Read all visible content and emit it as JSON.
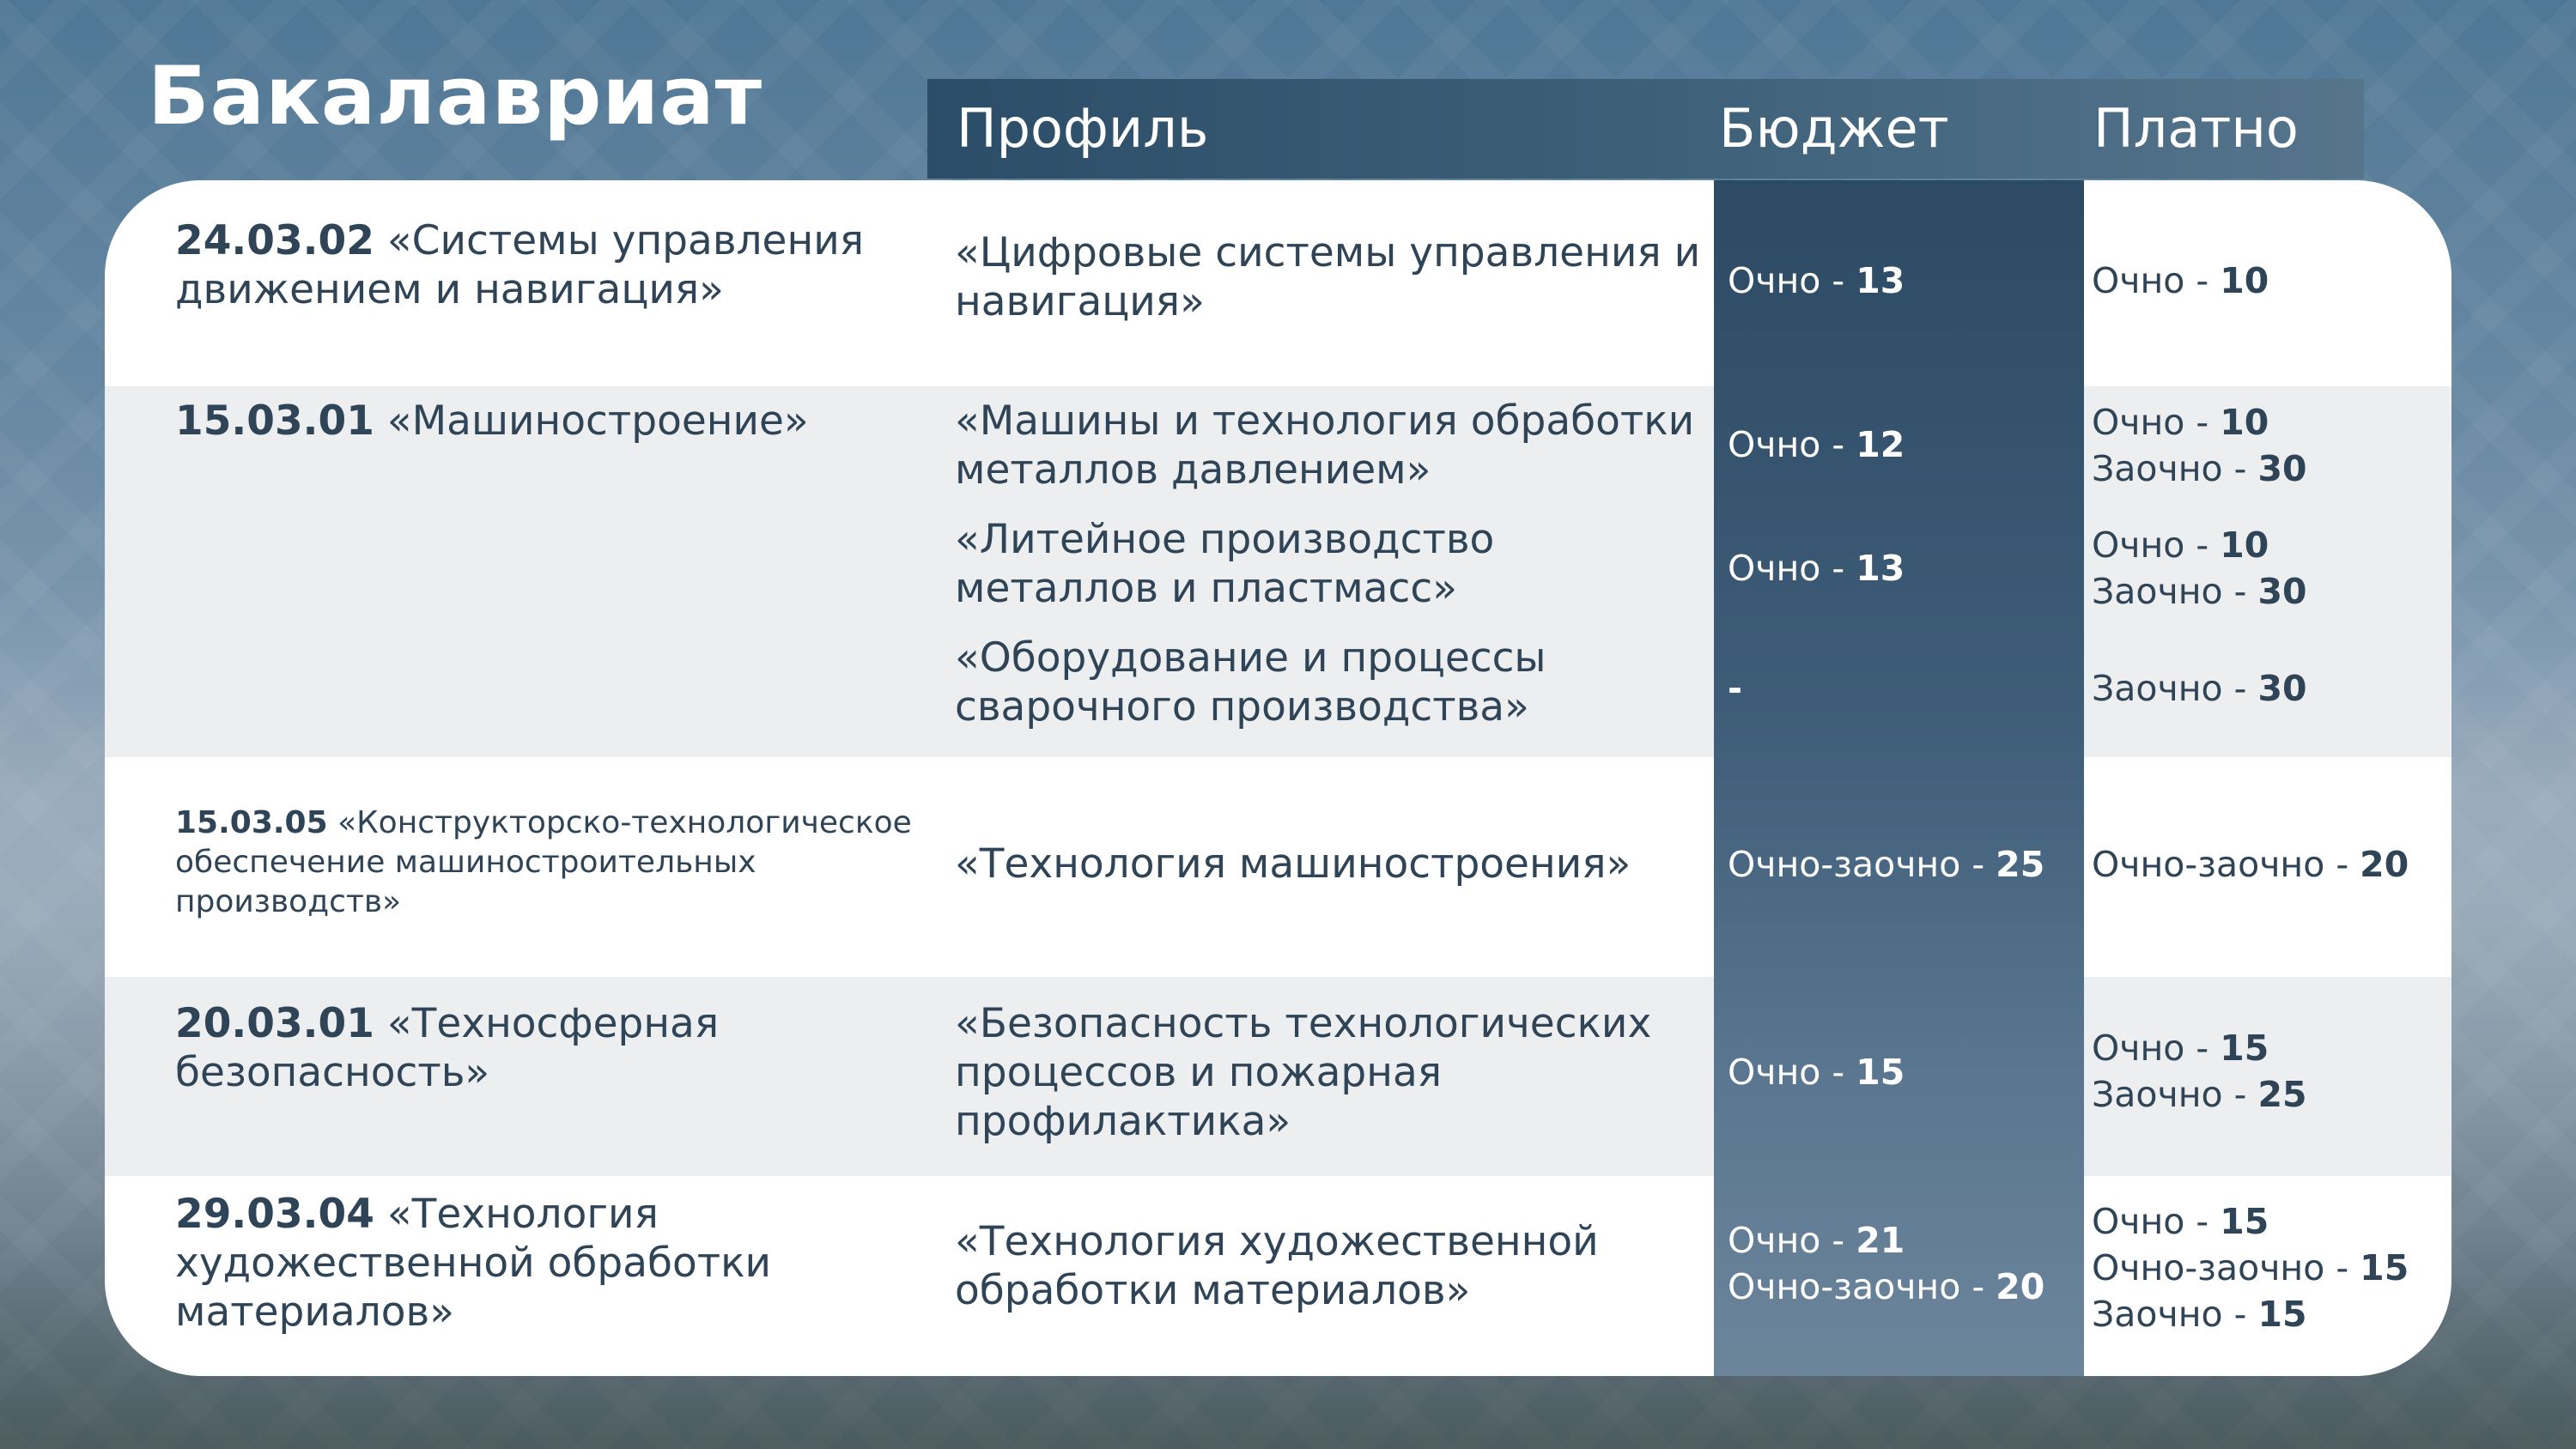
{
  "title": "Бакалавриат",
  "header": {
    "profile": "Профиль",
    "budget": "Бюджет",
    "paid": "Платно"
  },
  "rows": [
    {
      "code": "24.03.02",
      "direction": " «Системы управления движением и навигация»",
      "profiles": [
        {
          "name": "«Цифровые системы управления и навигация»",
          "budget": [
            {
              "mode": "Очно - ",
              "seats": "13"
            }
          ],
          "paid": [
            {
              "mode": "Очно - ",
              "seats": "10"
            }
          ]
        }
      ]
    },
    {
      "code": "15.03.01",
      "direction": " «Машиностроение»",
      "profiles": [
        {
          "name": "«Машины и технология обработки металлов давлением»",
          "budget": [
            {
              "mode": "Очно - ",
              "seats": "12"
            }
          ],
          "paid": [
            {
              "mode": "Очно - ",
              "seats": "10"
            },
            {
              "mode": "Заочно - ",
              "seats": "30"
            }
          ]
        },
        {
          "name": "«Литейное производство металлов и пластмасс»",
          "budget": [
            {
              "mode": "Очно - ",
              "seats": "13"
            }
          ],
          "paid": [
            {
              "mode": "Очно - ",
              "seats": "10"
            },
            {
              "mode": "Заочно - ",
              "seats": "30"
            }
          ]
        },
        {
          "name": "«Оборудование и процессы сварочного производства»",
          "budget_dash": "-",
          "paid": [
            {
              "mode": "Заочно - ",
              "seats": "30"
            }
          ]
        }
      ]
    },
    {
      "code": "15.03.05",
      "direction": " «Конструкторско-технологическое обеспечение машиностроительных производств»",
      "profiles": [
        {
          "name": "«Технология машиностроения»",
          "budget": [
            {
              "mode": "Очно-заочно - ",
              "seats": "25"
            }
          ],
          "paid": [
            {
              "mode": "Очно-заочно - ",
              "seats": "20"
            }
          ]
        }
      ]
    },
    {
      "code": "20.03.01",
      "direction": " «Техносферная безопасность»",
      "profiles": [
        {
          "name": "«Безопасность технологических процессов и пожарная профилактика»",
          "budget": [
            {
              "mode": "Очно - ",
              "seats": "15"
            }
          ],
          "paid": [
            {
              "mode": "Очно - ",
              "seats": "15"
            },
            {
              "mode": "Заочно - ",
              "seats": "25"
            }
          ]
        }
      ]
    },
    {
      "code": "29.03.04",
      "direction": " «Технология художественной обработки материалов»",
      "profiles": [
        {
          "name": "«Технология художественной обработки материалов»",
          "budget": [
            {
              "mode": "Очно - ",
              "seats": "21"
            },
            {
              "mode": "Очно-заочно - ",
              "seats": "20"
            }
          ],
          "paid": [
            {
              "mode": "Очно - ",
              "seats": "15"
            },
            {
              "mode": "Очно-заочно - ",
              "seats": "15"
            },
            {
              "mode": "Заочно - ",
              "seats": "15"
            }
          ]
        }
      ]
    }
  ]
}
